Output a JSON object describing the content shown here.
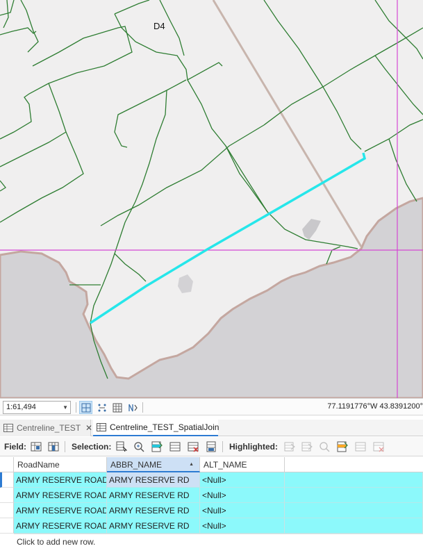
{
  "map": {
    "label": "D4",
    "colors": {
      "background": "#f0efef",
      "water": "#d3d2d5",
      "shoreline": "#c4a7a0",
      "roads": "#2e7d32",
      "highlight": "#26e6ea",
      "rail": "#c8b5ad",
      "grid": "#d448d4"
    }
  },
  "statusbar": {
    "scale": "1:61,494",
    "coordinates": "77.1191776°W 43.8391200°",
    "tools": [
      "snap-icon",
      "grid-snap-icon",
      "table-icon",
      "nav-toggle-icon"
    ]
  },
  "tabs": [
    {
      "label": "Centreline_TEST",
      "active": false,
      "icon": "table-icon",
      "close": "✕"
    },
    {
      "label": "Centreline_TEST_SpatialJoin",
      "active": true,
      "icon": "table-icon"
    }
  ],
  "toolbar": {
    "field_label": "Field:",
    "selection_label": "Selection:",
    "highlighted_label": "Highlighted:"
  },
  "table": {
    "columns": [
      "RoadName",
      "ABBR_NAME",
      "ALT_NAME"
    ],
    "sorted_column": "ABBR_NAME",
    "rows": [
      {
        "RoadName": "ARMY RESERVE ROAD",
        "ABBR_NAME": "ARMY RESERVE RD",
        "ALT_NAME": "<Null>"
      },
      {
        "RoadName": "ARMY RESERVE ROAD",
        "ABBR_NAME": "ARMY RESERVE RD",
        "ALT_NAME": "<Null>"
      },
      {
        "RoadName": "ARMY RESERVE ROAD",
        "ABBR_NAME": "ARMY RESERVE RD",
        "ALT_NAME": "<Null>"
      },
      {
        "RoadName": "ARMY RESERVE ROAD",
        "ABBR_NAME": "ARMY RESERVE RD",
        "ALT_NAME": "<Null>"
      }
    ],
    "add_row_text": "Click to add new row."
  }
}
